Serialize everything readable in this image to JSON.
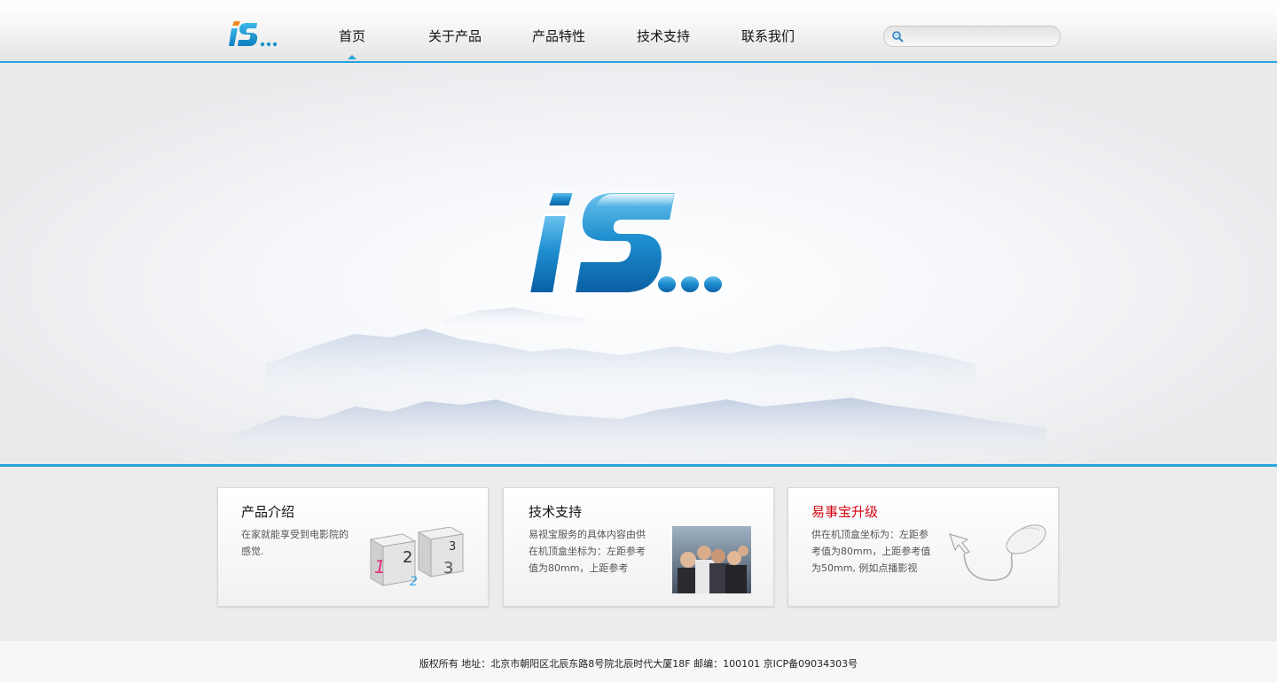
{
  "header": {
    "nav": [
      {
        "label": "首页",
        "active": true
      },
      {
        "label": "关于产品",
        "active": false
      },
      {
        "label": "产品特性",
        "active": false
      },
      {
        "label": "技术支持",
        "active": false
      },
      {
        "label": "联系我们",
        "active": false
      }
    ],
    "search": {
      "placeholder": "",
      "value": ""
    }
  },
  "cards": [
    {
      "title": "产品介绍",
      "text": "在家就能享受到电影院的感觉."
    },
    {
      "title": "技术支持",
      "text": "易视宝服务的具体内容由供在机顶盒坐标为：左距参考值为80mm，上距参考"
    },
    {
      "title": "易事宝升级",
      "text": "供在机顶盒坐标为：左距参考值为80mm，上距参考值为50mm, 例如点播影视"
    }
  ],
  "footer": {
    "text": "版权所有  地址：北京市朝阳区北辰东路8号院北辰时代大厦18F  邮编：100101  京ICP备09034303号"
  },
  "colors": {
    "accent": "#26a6dc",
    "title_red": "#d40010"
  }
}
